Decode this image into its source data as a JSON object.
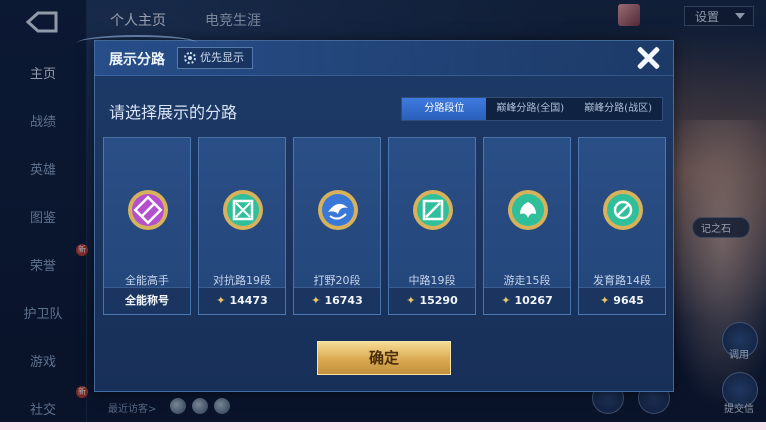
{
  "background": {
    "top_tabs": [
      "个人主页",
      "电竞生涯"
    ],
    "nav_items": [
      "主页",
      "战绩",
      "英雄",
      "图鉴",
      "荣誉",
      "护卫队",
      "游戏",
      "社交"
    ],
    "nav_badges": [
      "新",
      "新"
    ],
    "settings_label": "设置",
    "recent_visitors_label": "最近访客>",
    "side_chip": "记之石",
    "side_buttons": [
      "调用",
      "提交信"
    ]
  },
  "modal": {
    "title": "展示分路",
    "priority_label": "优先显示",
    "subtitle": "请选择展示的分路",
    "tabs": [
      {
        "label": "分路段位",
        "active": true
      },
      {
        "label": "巅峰分路(全国)",
        "active": false
      },
      {
        "label": "巅峰分路(战区)",
        "active": false
      }
    ],
    "cards": [
      {
        "role": "全能高手",
        "value": "全能称号",
        "emblem": "all-rounder-emblem-icon",
        "color": "#b44fd0",
        "star": false
      },
      {
        "role": "对抗路19段",
        "value": "14473",
        "emblem": "clash-lane-emblem-icon",
        "color": "#2fbf9a",
        "star": true
      },
      {
        "role": "打野20段",
        "value": "16743",
        "emblem": "jungle-emblem-icon",
        "color": "#3a78d8",
        "star": true
      },
      {
        "role": "中路19段",
        "value": "15290",
        "emblem": "mid-lane-emblem-icon",
        "color": "#2fbf9a",
        "star": true
      },
      {
        "role": "游走15段",
        "value": "10267",
        "emblem": "roam-emblem-icon",
        "color": "#2fbf9a",
        "star": true
      },
      {
        "role": "发育路14段",
        "value": "9645",
        "emblem": "farm-lane-emblem-icon",
        "color": "#2fbf9a",
        "star": true
      }
    ],
    "confirm_label": "确定"
  }
}
